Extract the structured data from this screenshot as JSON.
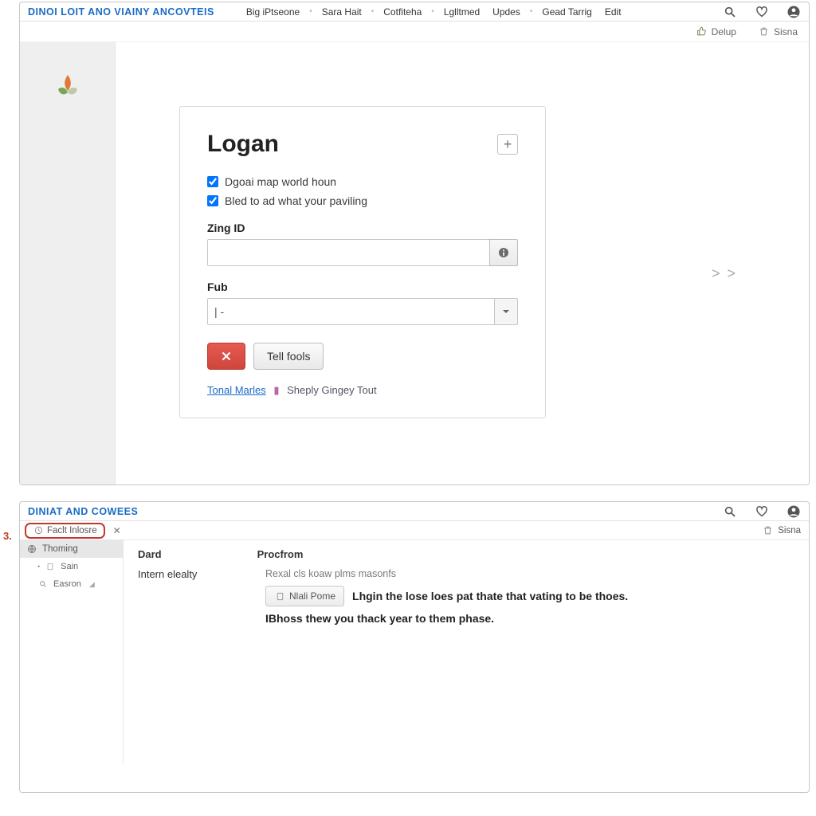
{
  "window1": {
    "brand": "DINOI LOIT ANO VIAINY ANCOVTEIS",
    "nav": [
      "Big iPtseone",
      "Sara Hait",
      "Cotfiteha",
      "Lglltmed",
      "Updes",
      "Gead Tarrig",
      "Edit"
    ],
    "subbar": {
      "left_label": "Delup",
      "right_label": "Sisna"
    },
    "card": {
      "title": "Logan",
      "check1": "Dgoai map world houn",
      "check2": "Bled to ad what your paviling",
      "field1_label": "Zing ID",
      "field2_label": "Fub",
      "select_value": "| -",
      "secondary_btn": "Tell fools",
      "link1": "Tonal Marles",
      "link2": "Sheply Gingey Tout"
    },
    "chevrons": "> >"
  },
  "window2": {
    "brand": "DINIAT AND COWEES",
    "annot": "3.",
    "tab_label": "Faclt Inlosre",
    "subbar_right": "Sisna",
    "sidebar": {
      "item1": "Thoming",
      "item2": "Sain",
      "item3": "Easron"
    },
    "headers": {
      "c1": "Dard",
      "c2": "Procfrom"
    },
    "row_label": "Intern elealty",
    "subtle": "Rexal cls koaw plms masonfs",
    "inline_btn": "Nlali Pome",
    "body1": "Lhgin the lose loes pat thate that vating to be thoes.",
    "body2": "IBhoss thew you thack year to them phase."
  }
}
